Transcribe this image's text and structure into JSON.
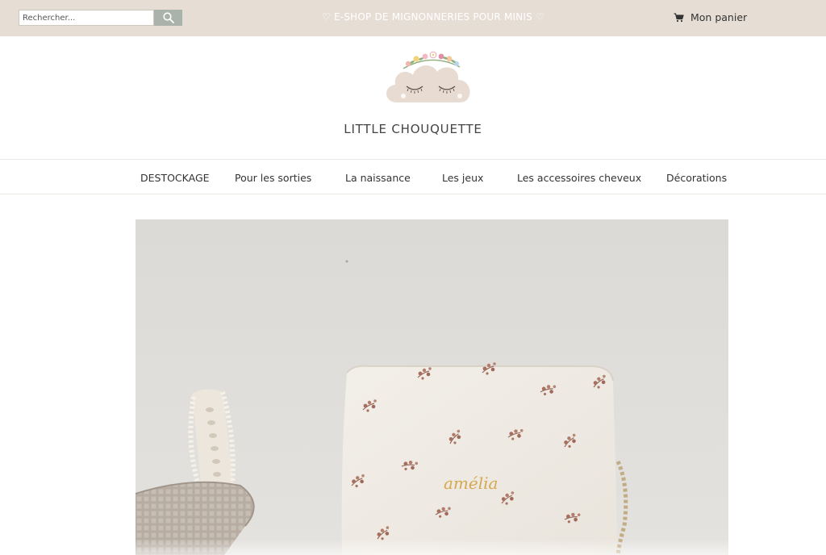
{
  "header": {
    "search": {
      "placeholder": "Rechercher..."
    },
    "tagline": "♡ E-SHOP DE MIGNONNERIES POUR MINIS ♡",
    "cart_label": "Mon panier"
  },
  "brand": {
    "name": "LITTLE CHOUQUETTE"
  },
  "nav": {
    "items": [
      {
        "label": "DESTOCKAGE"
      },
      {
        "label": "Pour les sorties"
      },
      {
        "label": "La naissance"
      },
      {
        "label": "Les jeux"
      },
      {
        "label": "Les accessoires cheveux"
      },
      {
        "label": "Décorations"
      }
    ]
  },
  "hero": {
    "embroidered_name": "amélia"
  },
  "colors": {
    "topbar_bg": "#e6ded4",
    "search_button": "#a9b3ab",
    "logo_cloud": "#e8dcd2"
  },
  "icons": {
    "search": "search-icon",
    "cart": "cart-icon"
  }
}
